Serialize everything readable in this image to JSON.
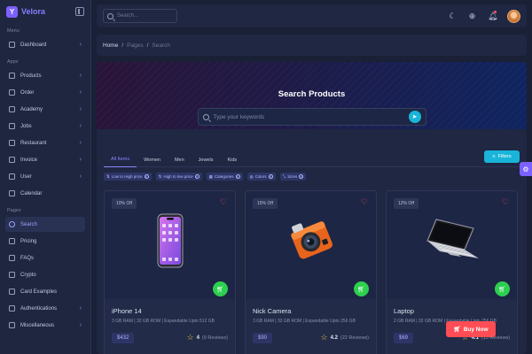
{
  "brand": {
    "name": "Velora",
    "logo_letter": "Y"
  },
  "sidebar": {
    "sections": [
      {
        "title": "Menu",
        "items": [
          {
            "label": "Dashboard",
            "icon": "grid-icon",
            "chevron": true
          }
        ]
      },
      {
        "title": "Apps",
        "items": [
          {
            "label": "Products",
            "icon": "box-icon",
            "chevron": true
          },
          {
            "label": "Order",
            "icon": "cart-icon",
            "chevron": true
          },
          {
            "label": "Academy",
            "icon": "graduation-icon",
            "chevron": true
          },
          {
            "label": "Jobs",
            "icon": "briefcase-icon",
            "chevron": true
          },
          {
            "label": "Restaurant",
            "icon": "restaurant-icon",
            "chevron": true
          },
          {
            "label": "Invoice",
            "icon": "invoice-icon",
            "chevron": true
          },
          {
            "label": "User",
            "icon": "user-icon",
            "chevron": true
          },
          {
            "label": "Calendar",
            "icon": "calendar-icon",
            "chevron": false
          }
        ]
      },
      {
        "title": "Pages",
        "items": [
          {
            "label": "Search",
            "icon": "search-icon",
            "chevron": false,
            "active": true
          },
          {
            "label": "Pricing",
            "icon": "dollar-icon",
            "chevron": false
          },
          {
            "label": "FAQs",
            "icon": "question-icon",
            "chevron": false
          },
          {
            "label": "Crypto",
            "icon": "bitcoin-icon",
            "chevron": false
          },
          {
            "label": "Card Examples",
            "icon": "card-icon",
            "chevron": false
          },
          {
            "label": "Authentications",
            "icon": "lock-icon",
            "chevron": true
          },
          {
            "label": "Miscellaneous",
            "icon": "layers-icon",
            "chevron": true
          }
        ]
      }
    ]
  },
  "topbar": {
    "search_placeholder": "Search..."
  },
  "breadcrumb": {
    "home": "Home",
    "sep": "/",
    "pages": "Pages",
    "current": "Search"
  },
  "hero": {
    "title": "Search Products",
    "search_placeholder": "Type your keywords",
    "send_icon": "arrow-right-icon"
  },
  "tabs": [
    "All Items",
    "Women",
    "Men",
    "Jewels",
    "Kids"
  ],
  "filters_label": "Filters",
  "chips": [
    "Low to High price",
    "High to low price",
    "Categories",
    "Colors",
    "Sizes"
  ],
  "products": [
    {
      "badge": "10% Off",
      "name": "iPhone 14",
      "spec": "3 GB RAM | 32 GB ROM | Expandable Upto 512 GB",
      "price": "$432",
      "rating": "4",
      "reviews": "(9 Reviews)"
    },
    {
      "badge": "15% Off",
      "name": "Nick Camera",
      "spec": "3 GB RAM | 32 GB ROM | Expandable Upto 256 GB",
      "price": "$90",
      "rating": "4.2",
      "reviews": "(22 Reviews)"
    },
    {
      "badge": "12% Off",
      "name": "Laptop",
      "spec": "2 GB RAM | 32 GB ROM | Expandable Upto 256 GB",
      "price": "$69",
      "rating": "4.1",
      "reviews": "(15 Reviews)"
    }
  ],
  "buy_now": "Buy Now",
  "colors": {
    "accent": "#7b61ff",
    "cyan": "#19b4d8",
    "green": "#2dcf4f",
    "red": "#ff4d55",
    "star": "#f6c344"
  }
}
